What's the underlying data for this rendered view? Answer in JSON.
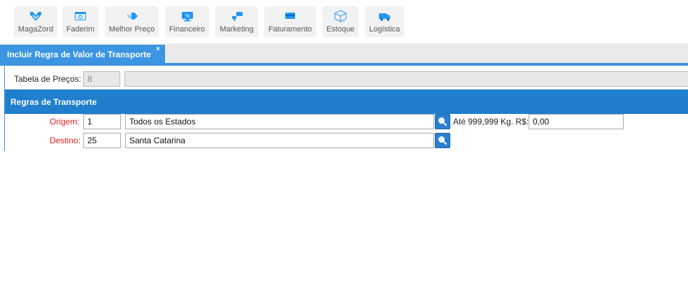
{
  "toolbar": {
    "items": [
      {
        "label": "MagaZord",
        "icon": "magazord-logo-icon"
      },
      {
        "label": "Faderim",
        "icon": "browser-window-icon"
      },
      {
        "label": "Melhor Preço",
        "icon": "price-tag-icon"
      },
      {
        "label": "Financeiro",
        "icon": "monitor-money-icon"
      },
      {
        "label": "Marketing",
        "icon": "megaphone-icon"
      },
      {
        "label": "Faturamento",
        "icon": "invoice-icon"
      },
      {
        "label": "Estoque",
        "icon": "box-icon"
      },
      {
        "label": "Logística",
        "icon": "truck-icon"
      }
    ],
    "accent": "#2196f3"
  },
  "tab": {
    "title": "Incluir Regra de Valor de Transporte",
    "close": "×"
  },
  "form": {
    "tabela_label": "Tabela de Preços:",
    "tabela_value": "8",
    "tabela_desc": "",
    "section_title": "Regras de Transporte",
    "origem_label": "Origem:",
    "origem_code": "1",
    "origem_desc": "Todos os Estados",
    "valor_label": "Até 999,999 Kg. R$:",
    "valor_value": "0,00",
    "destino_label": "Destino:",
    "destino_code": "25",
    "destino_desc": "Santa Catarina"
  },
  "colors": {
    "tab_blue": "#3b95e0",
    "section_blue": "#1f7fcd",
    "required_red": "#e02020"
  }
}
